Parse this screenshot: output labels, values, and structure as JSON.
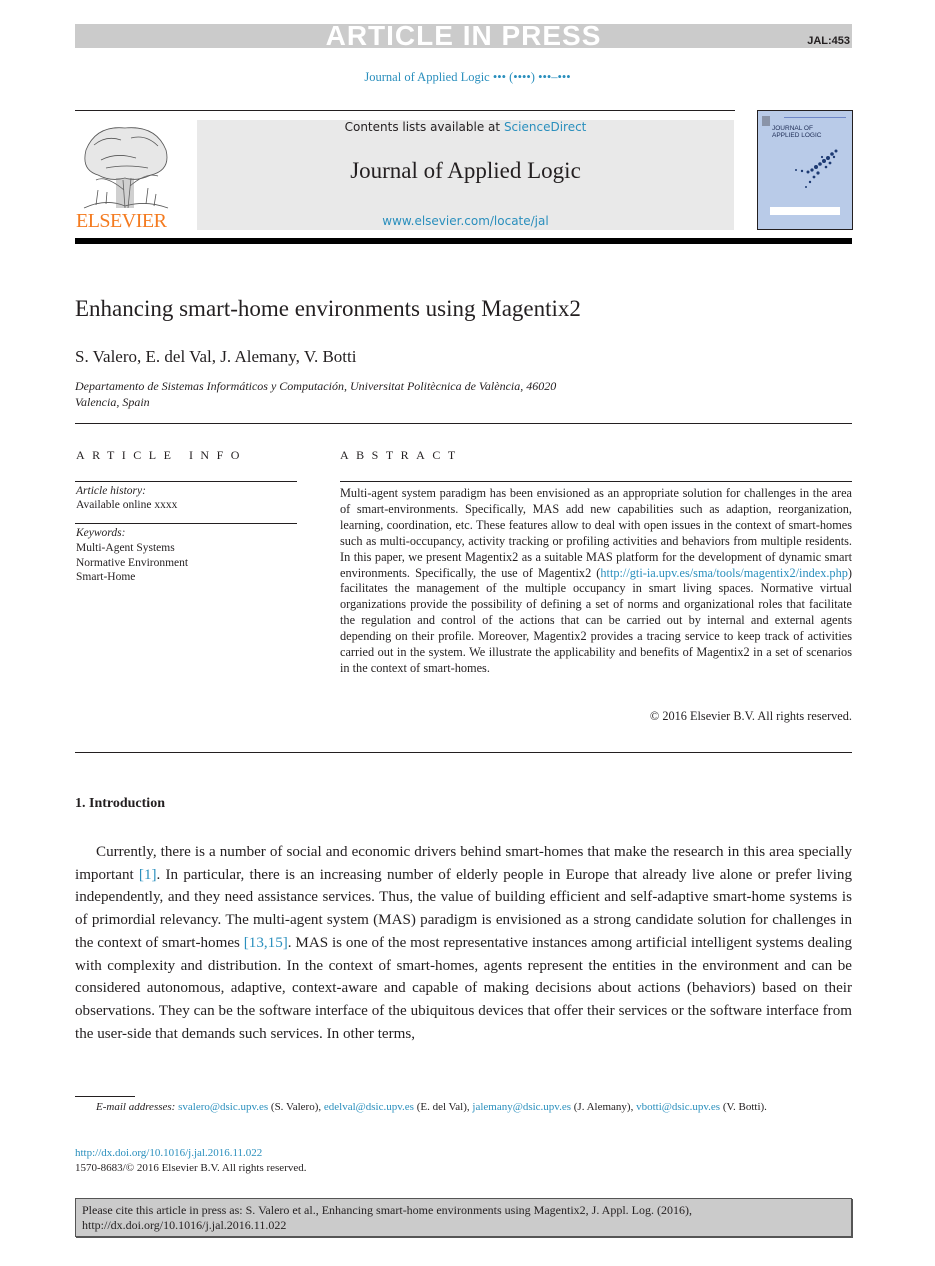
{
  "banner": {
    "status": "ARTICLE IN PRESS",
    "code": "JAL:453"
  },
  "running_head": "Journal of Applied Logic ••• (••••) •••–•••",
  "masthead": {
    "publisher_logo_text": "ELSEVIER",
    "contents_prefix": "Contents lists available at ",
    "contents_link": "ScienceDirect",
    "journal_name": "Journal of Applied Logic",
    "journal_url": "www.elsevier.com/locate/jal",
    "cover_title_line1": "JOURNAL OF",
    "cover_title_line2": "APPLIED LOGIC"
  },
  "article": {
    "title": "Enhancing smart-home environments using Magentix2",
    "authors": "S. Valero, E. del Val, J. Alemany, V. Botti",
    "affiliation_line1": "Departamento de Sistemas Informáticos y Computación, Universitat Politècnica de València, 46020",
    "affiliation_line2": "Valencia, Spain"
  },
  "article_info": {
    "heading": "ARTICLE INFO",
    "history_label": "Article history:",
    "history_value": "Available online xxxx",
    "keywords_label": "Keywords:",
    "keywords": [
      "Multi-Agent Systems",
      "Normative Environment",
      "Smart-Home"
    ]
  },
  "abstract": {
    "heading": "ABSTRACT",
    "text_before_link": "Multi-agent system paradigm has been envisioned as an appropriate solution for challenges in the area of smart-environments. Specifically, MAS add new capabilities such as adaption, reorganization, learning, coordination, etc. These features allow to deal with open issues in the context of smart-homes such as multi-occupancy, activity tracking or profiling activities and behaviors from multiple residents. In this paper, we present Magentix2 as a suitable MAS platform for the development of dynamic smart environments. Specifically, the use of Magentix2 (",
    "link": "http://gti-ia.upv.es/sma/tools/magentix2/index.php",
    "text_after_link": ") facilitates the management of the multiple occupancy in smart living spaces. Normative virtual organizations provide the possibility of defining a set of norms and organizational roles that facilitate the regulation and control of the actions that can be carried out by internal and external agents depending on their profile. Moreover, Magentix2 provides a tracing service to keep track of activities carried out in the system. We illustrate the applicability and benefits of Magentix2 in a set of scenarios in the context of smart-homes.",
    "copyright": "© 2016 Elsevier B.V. All rights reserved."
  },
  "introduction": {
    "heading": "1.  Introduction",
    "p1": "Currently, there is a number of social and economic drivers behind smart-homes that make the research in this area specially important ",
    "ref1": "[1]",
    "p2": ". In particular, there is an increasing number of elderly people in Europe that already live alone or prefer living independently, and they need assistance services. Thus, the value of building efficient and self-adaptive smart-home systems is of primordial relevancy. The multi-agent system (MAS) paradigm is envisioned as a strong candidate solution for challenges in the context of smart-homes ",
    "ref2": "[13,15]",
    "p3": ". MAS is one of the most representative instances among artificial intelligent systems dealing with complexity and distribution. In the context of smart-homes, agents represent the entities in the environment and can be considered autonomous, adaptive, context-aware and capable of making decisions about actions (behaviors) based on their observations. They can be the software interface of the ubiquitous devices that offer their services or the software interface from the user-side that demands such services. In other terms,"
  },
  "footnotes": {
    "email_label": "E-mail addresses:",
    "emails": [
      {
        "address": "svalero@dsic.upv.es",
        "name": "(S. Valero),"
      },
      {
        "address": "edelval@dsic.upv.es",
        "name": "(E. del Val),"
      },
      {
        "address": "jalemany@dsic.upv.es",
        "name": "(J. Alemany),"
      },
      {
        "address": "vbotti@dsic.upv.es",
        "name": "(V. Botti)."
      }
    ],
    "doi": "http://dx.doi.org/10.1016/j.jal.2016.11.022",
    "issn": "1570-8683/© 2016 Elsevier B.V. All rights reserved."
  },
  "citation": {
    "line1": "Please cite this article in press as: S. Valero et al., Enhancing smart-home environments using Magentix2, J. Appl. Log. (2016),",
    "line2": "http://dx.doi.org/10.1016/j.jal.2016.11.022"
  },
  "colors": {
    "link": "#2a8fbd",
    "elsevier_orange": "#f47b20",
    "banner_gray": "#cbcbcb"
  }
}
